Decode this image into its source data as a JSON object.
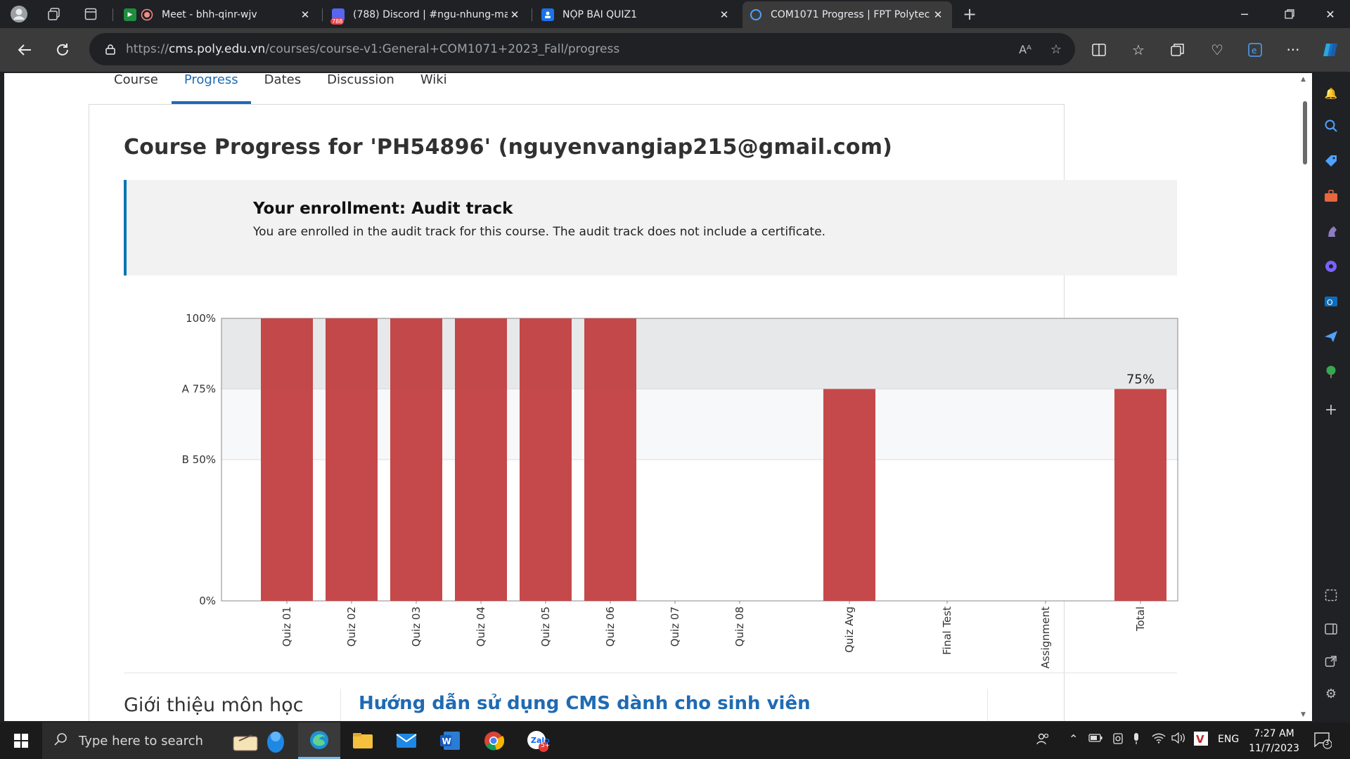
{
  "browser": {
    "tabs": [
      {
        "title": "Meet - bhh-qinr-wjv",
        "active": false
      },
      {
        "title": "(788) Discord | #ngu-nhung-ma-",
        "active": false
      },
      {
        "title": "NỘP BÀI QUIZ1",
        "active": false
      },
      {
        "title": "COM1071 Progress | FPT Polytec",
        "active": true
      }
    ],
    "discord_badge": "788",
    "url_prefix": "https://",
    "url_domain": "cms.poly.edu.vn",
    "url_path": "/courses/course-v1:General+COM1071+2023_Fall/progress",
    "read_aloud_label": "Aᴬ"
  },
  "course_nav": {
    "items": [
      "Course",
      "Progress",
      "Dates",
      "Discussion",
      "Wiki"
    ],
    "active": "Progress"
  },
  "progress": {
    "title": "Course Progress for 'PH54896' (nguyenvangiap215@gmail.com)",
    "enrollment_heading": "Your enrollment: Audit track",
    "enrollment_message": "You are enrolled in the audit track for this course. The audit track does not include a certificate."
  },
  "chart_data": {
    "type": "bar",
    "categories": [
      "Quiz 01",
      "Quiz 02",
      "Quiz 03",
      "Quiz 04",
      "Quiz 05",
      "Quiz 06",
      "Quiz 07",
      "Quiz 08",
      "Quiz Avg",
      "Final Test",
      "Assignment",
      "Total"
    ],
    "values": [
      100,
      100,
      100,
      100,
      100,
      100,
      0,
      0,
      75,
      0,
      0,
      75
    ],
    "ylim": [
      0,
      100
    ],
    "yticks": [
      {
        "value": 100,
        "label": "100%"
      },
      {
        "value": 75,
        "label": "A 75%"
      },
      {
        "value": 50,
        "label": "B 50%"
      },
      {
        "value": 0,
        "label": "0%"
      }
    ],
    "total_label": "75%",
    "bar_color": "#c0393b",
    "band_colors": {
      "above_A": "#e6e8ea",
      "A_to_B": "#f7f8f9",
      "below_B": "#ffffff"
    }
  },
  "bottom_section": {
    "intro_title": "Giới thiệu môn học",
    "guide_link": "Hướng dẫn sử dụng CMS dành cho sinh viên"
  },
  "taskbar": {
    "search_placeholder": "Type here to search",
    "language": "ENG",
    "time": "7:27 AM",
    "date": "11/7/2023",
    "notification_count": "3",
    "zalo_badge": "5+"
  }
}
